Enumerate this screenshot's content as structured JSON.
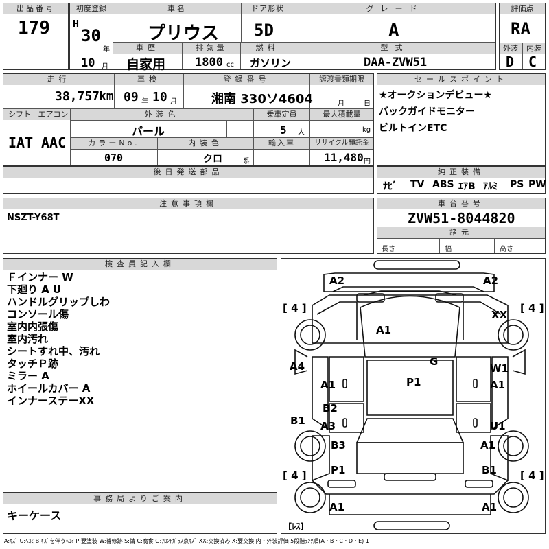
{
  "header": {
    "lot_label": "出品番号",
    "lot_number": "179",
    "first_reg_label": "初度登録",
    "first_reg_era": "H",
    "first_reg_year": "30",
    "year_unit": "年",
    "month_unit": "月",
    "car_name_label": "車名",
    "car_name": "プリウス",
    "door_label": "ドア形状",
    "door": "5D",
    "grade_label": "グレード",
    "grade": "A",
    "score_label": "評価点",
    "score": "RA",
    "history_label": "車歴",
    "first_reg_month": "10",
    "history": "自家用",
    "displacement_label": "排気量",
    "displacement": "1800",
    "displacement_unit": "cc",
    "fuel_label": "燃料",
    "fuel": "ガソリン",
    "model_label": "型式",
    "model": "DAA-ZVW51",
    "exterior_label": "外装",
    "interior_label": "内装",
    "exterior_grade": "D",
    "interior_grade": "C"
  },
  "row2": {
    "mileage_label": "走行",
    "mileage": "38,757",
    "mileage_unit": "km",
    "inspection_label": "車検",
    "inspection_year": "09",
    "inspection_month": "10",
    "reg_label": "登録番号",
    "reg_number": "湘南 330ソ4604",
    "transfer_label": "譲渡書類期限",
    "transfer_month_unit": "月",
    "transfer_day_unit": "日",
    "sales_label": "セールスポイント",
    "sales_points": [
      "★オークションデビュー★",
      "バックガイドモニター",
      "ビルトインETC"
    ],
    "shift_label": "シフト",
    "ac_label": "エアコン",
    "color_label": "外装色",
    "capacity_label": "乗車定員",
    "load_label": "最大積載量",
    "color": "パール",
    "capacity": "5",
    "capacity_unit": "人",
    "load_unit": "kg",
    "shift": "IAT",
    "ac": "AAC",
    "color_no_label": "カラーNo.",
    "int_color_label": "内装色",
    "import_label": "輸入車",
    "recycle_label": "リサイクル預託金",
    "color_no": "070",
    "int_color": "クロ",
    "int_color_unit": "系",
    "recycle": "11,480",
    "recycle_unit": "円",
    "later_parts_label": "後日発送部品",
    "equipment_label": "純正装備",
    "equipment": [
      "ﾅﾋﾞ",
      "TV",
      "ABS",
      "ｴｱB",
      "ｱﾙﾐ",
      "PS",
      "PW"
    ]
  },
  "notes": {
    "label": "注意事項欄",
    "text": "NSZT-Y68T",
    "chassis_label": "車台番号",
    "chassis": "ZVW51-8044820",
    "specs_label": "諸元",
    "length_label": "長さ",
    "width_label": "幅",
    "height_label": "高さ"
  },
  "inspector": {
    "label": "検査員記入欄",
    "lines": [
      "Ｆインナー W",
      "下廻り A U",
      "ハンドルグリップしわ",
      "コンソール傷",
      "室内内張傷",
      "室内汚れ",
      "シートすれ中、汚れ",
      "タッチＰ跡",
      "ミラー A",
      "ホイールカバー A",
      "インナーステーXX"
    ]
  },
  "office": {
    "label": "事務局よりご案内",
    "text": "キーケース"
  },
  "diagram": {
    "marks": [
      "A2",
      "A2",
      "[ 4 ]",
      "[ 4 ]",
      "XX",
      "A1",
      "A4",
      "G",
      "W1",
      "A1",
      "P1",
      "A1",
      "B2",
      "B1",
      "A3",
      "U1",
      "B3",
      "A1",
      "P1",
      "B1",
      "[ 4 ]",
      "[ 4 ]",
      "A1",
      "A1",
      "[ﾚｽ]"
    ]
  },
  "legend": "A:ｷｽﾞ U:ﾍｺﾐ B:ｷｽﾞを伴うﾍｺﾐ P:要塗装 W:補修跡 S:錆 C:腐食 G:ﾌﾛﾝﾄｶﾞﾗｽ点ｷｽﾞ XX:交換済み X:要交換 内・外装評価 5段階ﾗﾝｸ順(A・B・C・D・E) 1"
}
